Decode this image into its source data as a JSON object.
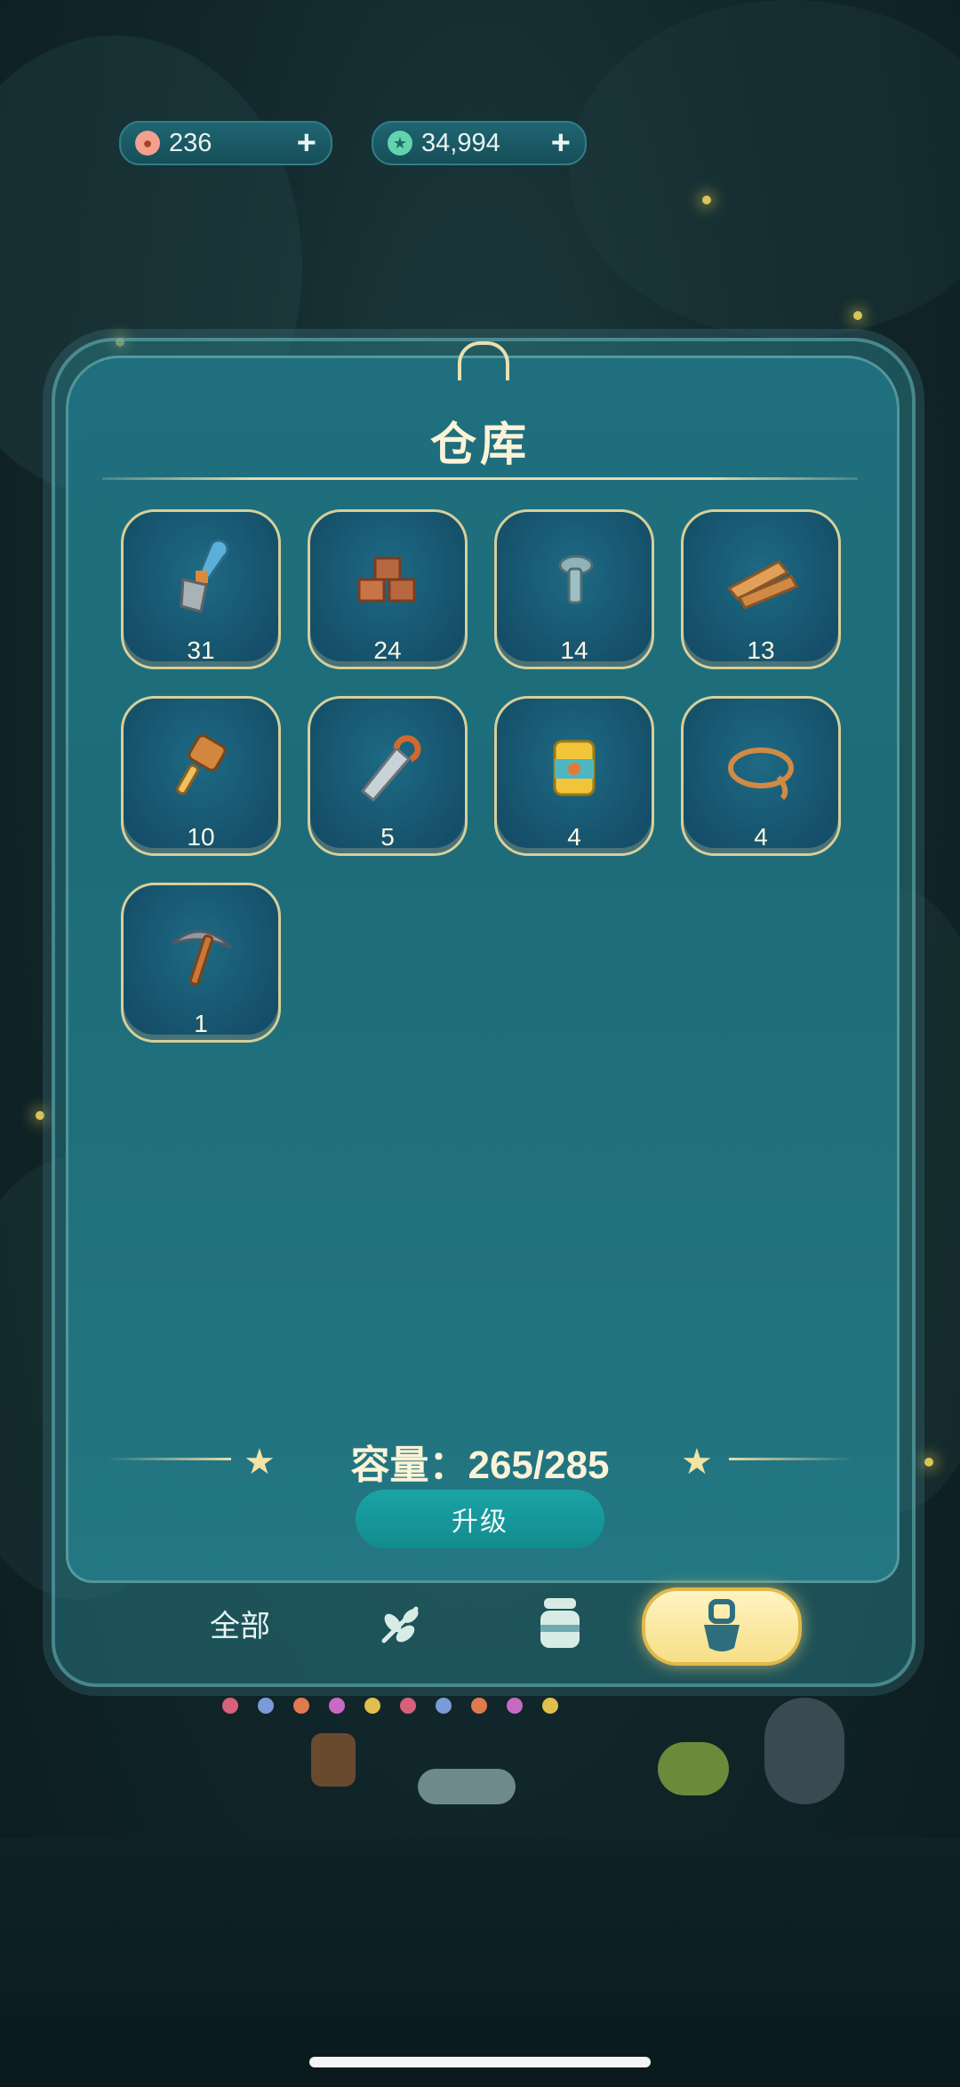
{
  "currencies": [
    {
      "icon": "coin-icon",
      "value": "236",
      "color": "#f2a18c"
    },
    {
      "icon": "star-gem-icon",
      "value": "34,994",
      "color": "#63d2b0"
    }
  ],
  "panel": {
    "title": "仓库",
    "items": [
      {
        "icon": "shovel-icon",
        "count": "31"
      },
      {
        "icon": "wood-blocks-icon",
        "count": "24"
      },
      {
        "icon": "screw-icon",
        "count": "14"
      },
      {
        "icon": "wood-planks-icon",
        "count": "13"
      },
      {
        "icon": "mallet-icon",
        "count": "10"
      },
      {
        "icon": "saw-icon",
        "count": "5"
      },
      {
        "icon": "paint-can-icon",
        "count": "4"
      },
      {
        "icon": "rope-icon",
        "count": "4"
      },
      {
        "icon": "pickaxe-icon",
        "count": "1"
      }
    ],
    "capacity": "容量：265/285",
    "upgrade_label": "升级"
  },
  "tabs": [
    {
      "label": "全部",
      "active": false
    },
    {
      "icon": "plant-icon",
      "active": false
    },
    {
      "icon": "jar-icon",
      "active": false
    },
    {
      "icon": "tools-icon",
      "active": true
    }
  ],
  "colors": {
    "accent": "#f6df86",
    "panel": "#1f6f7e",
    "text": "#fbf3d8"
  }
}
